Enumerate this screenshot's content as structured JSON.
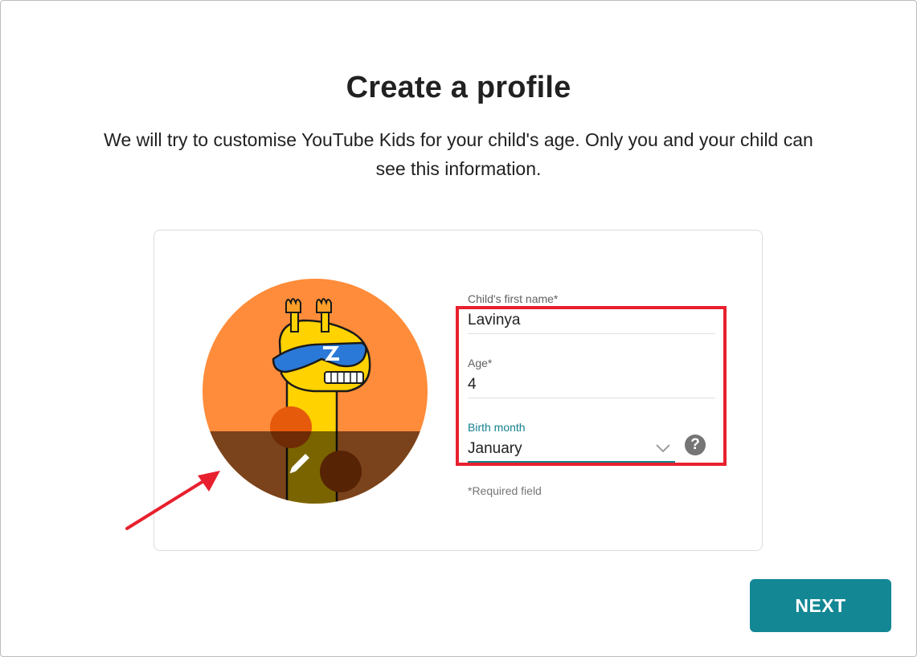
{
  "page": {
    "title": "Create a profile",
    "subtitle": "We will try to customise YouTube Kids for your child's age. Only you and your child can see this information."
  },
  "avatar": {
    "icon": "giraffe-with-sunglasses",
    "edit_icon": "pencil-icon"
  },
  "form": {
    "name": {
      "label": "Child's first name*",
      "value": "Lavinya"
    },
    "age": {
      "label": "Age*",
      "value": "4"
    },
    "birth_month": {
      "label": "Birth month",
      "value": "January",
      "help": "?"
    },
    "required_note": "*Required field"
  },
  "actions": {
    "next_label": "NEXT"
  },
  "colors": {
    "accent": "#13808d",
    "button": "#138794",
    "highlight": "#e8202e",
    "avatar_bg": "#ff8c3a"
  }
}
